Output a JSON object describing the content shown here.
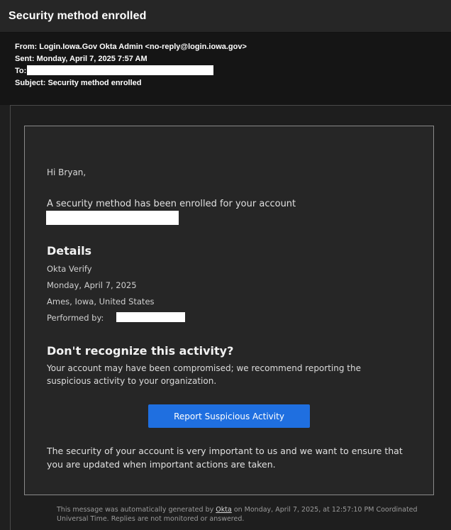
{
  "window": {
    "title": "Security method enrolled"
  },
  "email_headers": {
    "from_label": "From:",
    "from_value": "Login.Iowa.Gov Okta Admin <no-reply@login.iowa.gov>",
    "sent_label": "Sent:",
    "sent_value": "Monday, April 7, 2025 7:57 AM",
    "to_label": "To:",
    "subject_label": "Subject:",
    "subject_value": "Security method enrolled"
  },
  "message": {
    "greeting": "Hi Bryan,",
    "enrolled_text": "A security method has been enrolled for your account",
    "details_heading": "Details",
    "details": [
      "Okta Verify",
      "Monday, April 7, 2025",
      "Ames, Iowa, United States",
      "Performed by:"
    ],
    "warning_heading": "Don't recognize this activity?",
    "warning_text": "Your account may have been compromised; we recommend reporting the suspicious activity to your organization.",
    "report_button_label": "Report Suspicious Activity",
    "closing_text": "The security of your account is very important to us and we want to ensure that you are updated when important actions are taken."
  },
  "footer": {
    "prefix": "This message was automatically generated by ",
    "link_text": "Okta",
    "suffix": " on Monday, April 7, 2025, at 12:57:10 PM Coordinated Universal Time. Replies are not monitored or answered."
  },
  "colors": {
    "background": "#1f1f1f",
    "card": "#262626",
    "accent_button": "#1f6fe0",
    "redaction": "#ffffff"
  }
}
